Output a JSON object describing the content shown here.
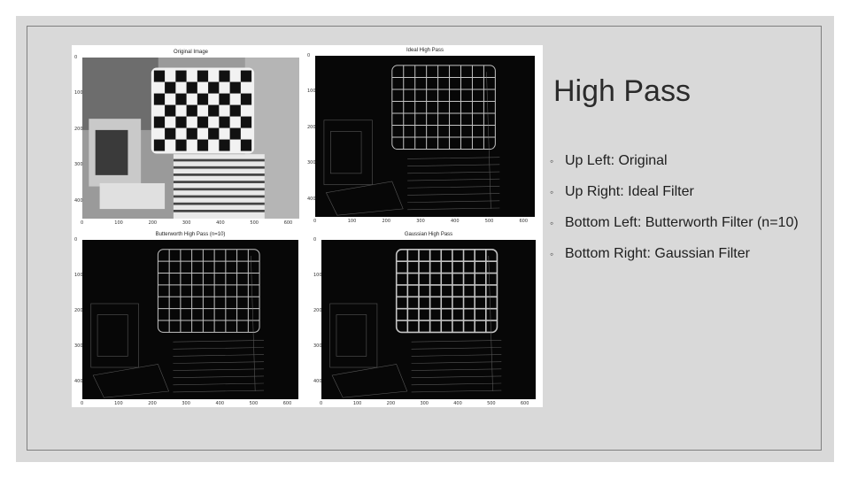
{
  "slide": {
    "title": "High Pass",
    "bullets": [
      {
        "marker": "◦",
        "text": "Up Left: Original"
      },
      {
        "marker": "◦",
        "text": "Up Right: Ideal Filter"
      },
      {
        "marker": "◦",
        "text": "Bottom Left: Butterworth Filter (n=10)"
      },
      {
        "marker": "◦",
        "text": "Bottom Right: Gaussian Filter"
      }
    ]
  },
  "figure": {
    "panels": [
      {
        "title": "Original Image",
        "type": "original",
        "y_ticks": [
          "0",
          "100",
          "200",
          "300",
          "400"
        ],
        "x_ticks": [
          "0",
          "100",
          "200",
          "300",
          "400",
          "500",
          "600"
        ]
      },
      {
        "title": "Ideal High Pass",
        "type": "edges",
        "y_ticks": [
          "0",
          "100",
          "200",
          "300",
          "400"
        ],
        "x_ticks": [
          "0",
          "100",
          "200",
          "300",
          "400",
          "500",
          "600"
        ]
      },
      {
        "title": "Butterworth High Pass (n=10)",
        "type": "edges",
        "y_ticks": [
          "0",
          "100",
          "200",
          "300",
          "400"
        ],
        "x_ticks": [
          "0",
          "100",
          "200",
          "300",
          "400",
          "500",
          "600"
        ]
      },
      {
        "title": "Gaussian High Pass",
        "type": "edges",
        "y_ticks": [
          "0",
          "100",
          "200",
          "300",
          "400"
        ],
        "x_ticks": [
          "0",
          "100",
          "200",
          "300",
          "400",
          "500",
          "600"
        ]
      }
    ]
  },
  "colors": {
    "background": "#d9d9d9",
    "frame": "#7f7f7f",
    "text": "#2b2b2b",
    "edge_line": "#d8d8d8"
  }
}
